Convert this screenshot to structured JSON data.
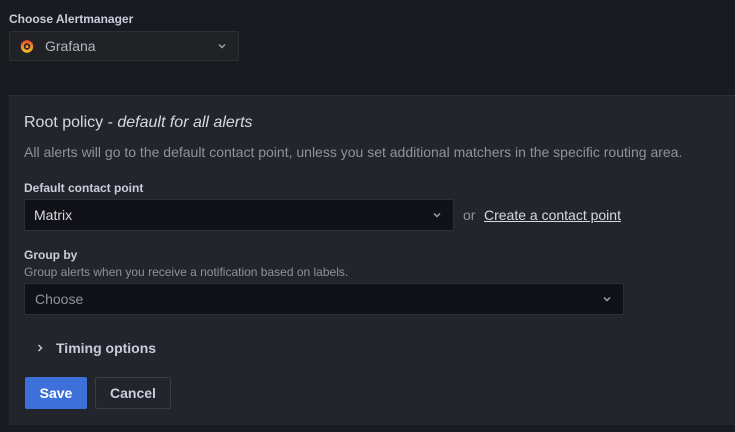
{
  "alertmanager": {
    "label": "Choose Alertmanager",
    "selected": "Grafana",
    "selected_icon": "grafana-logo-icon"
  },
  "root_policy": {
    "title": "Root policy",
    "title_separator": " - ",
    "title_emphasis": "default for all alerts",
    "description": "All alerts will go to the default contact point, unless you set additional matchers in the specific routing area."
  },
  "default_contact_point": {
    "label": "Default contact point",
    "value": "Matrix",
    "or_text": "or",
    "create_link": "Create a contact point"
  },
  "group_by": {
    "label": "Group by",
    "description": "Group alerts when you receive a notification based on labels.",
    "placeholder": "Choose"
  },
  "timing_options": {
    "label": "Timing options",
    "expanded": false
  },
  "actions": {
    "save_label": "Save",
    "cancel_label": "Cancel"
  },
  "colors": {
    "background": "#181b1f",
    "panel": "#22252b",
    "primary_button": "#3d71d9",
    "input_background": "#111217"
  }
}
